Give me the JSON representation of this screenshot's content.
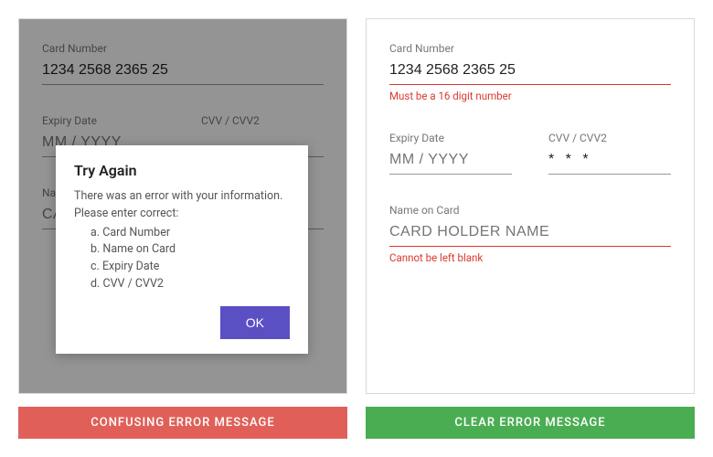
{
  "left": {
    "card_number_label": "Card Number",
    "card_number_value": "1234 2568 2365 25",
    "expiry_label": "Expiry Date",
    "expiry_placeholder": "MM / YYYY",
    "cvv_label": "CVV / CVV2",
    "cvv_value": "",
    "name_label": "Name on Card",
    "name_placeholder": "CARD HOLDER NAME",
    "modal": {
      "title": "Try Again",
      "intro1": "There was an error with your information.",
      "intro2": "Please enter correct:",
      "items": {
        "a": "a. Card Number",
        "b": "b. Name on Card",
        "c": "c. Expiry Date",
        "d": "d. CVV / CVV2"
      },
      "ok": "OK"
    },
    "caption": "CONFUSING ERROR MESSAGE"
  },
  "right": {
    "card_number_label": "Card Number",
    "card_number_value": "1234 2568 2365 25",
    "card_number_error": "Must be a 16 digit number",
    "expiry_label": "Expiry Date",
    "expiry_placeholder": "MM / YYYY",
    "cvv_label": "CVV / CVV2",
    "cvv_value": "* * *",
    "name_label": "Name on Card",
    "name_placeholder": "CARD HOLDER NAME",
    "name_error": "Cannot be left blank",
    "caption": "CLEAR ERROR MESSAGE"
  }
}
